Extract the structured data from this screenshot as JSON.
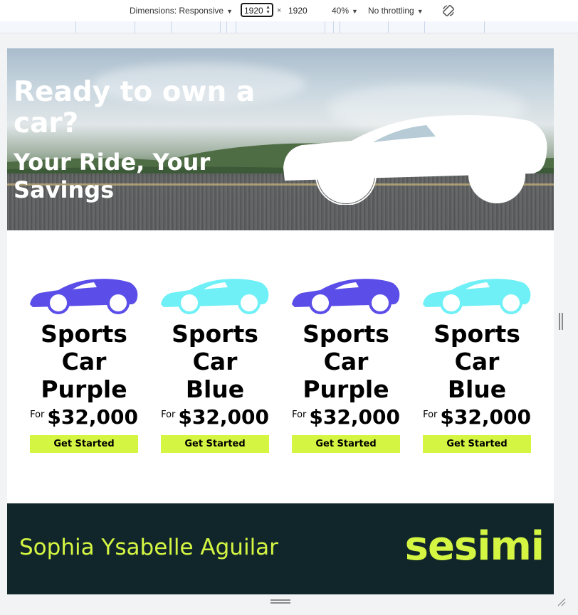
{
  "devtools": {
    "dimensions_label": "Dimensions: Responsive",
    "width_value": "1920",
    "height_value": "1920",
    "times_symbol": "×",
    "zoom": "40%",
    "throttling": "No throttling",
    "rotate_icon": "rotate-icon"
  },
  "hero": {
    "title": "Ready to own a car?",
    "subtitle": "Your Ride, Your Savings"
  },
  "cards": [
    {
      "name": "Sports Car Purple",
      "for_label": "For",
      "price": "$32,000",
      "cta": "Get Started",
      "car_color": "#5b4ee8"
    },
    {
      "name": "Sports Car Blue",
      "for_label": "For",
      "price": "$32,000",
      "cta": "Get Started",
      "car_color": "#6ff0f7"
    },
    {
      "name": "Sports Car Purple",
      "for_label": "For",
      "price": "$32,000",
      "cta": "Get Started",
      "car_color": "#5b4ee8"
    },
    {
      "name": "Sports Car Blue",
      "for_label": "For",
      "price": "$32,000",
      "cta": "Get Started",
      "car_color": "#6ff0f7"
    }
  ],
  "footer": {
    "name": "Sophia Ysabelle Aguilar",
    "logo": "sesimi"
  },
  "colors": {
    "accent": "#d4f542",
    "footer_bg": "#11262b",
    "purple": "#5b4ee8",
    "cyan": "#6ff0f7"
  }
}
